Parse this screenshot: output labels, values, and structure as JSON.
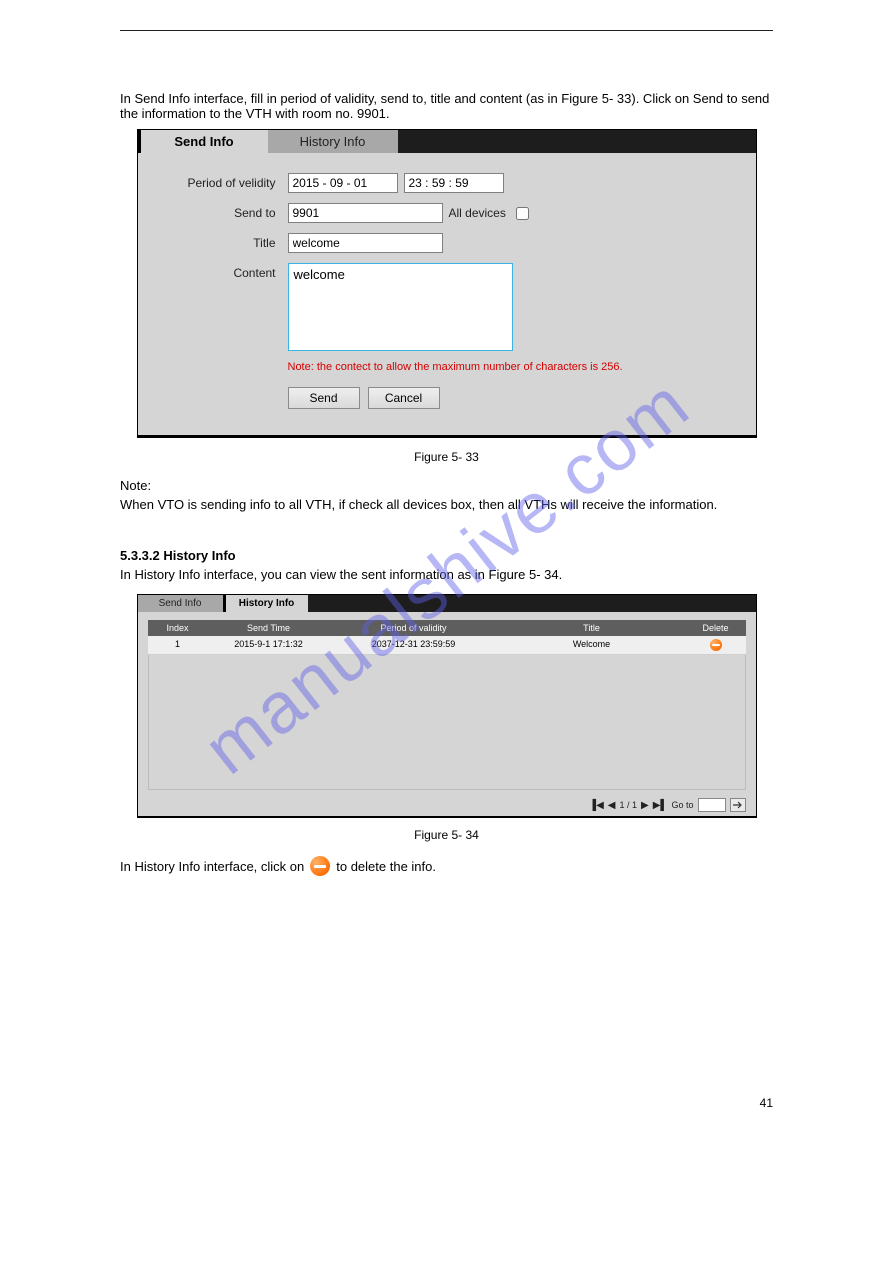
{
  "watermark": "manualshive.com",
  "intro": "In Send Info interface, fill in period of validity, send to, title and content (as in Figure 5- 33). Click on Send to send the information to the VTH with room no. 9901.",
  "pane1": {
    "tabs": {
      "active": "Send Info",
      "inactive": "History Info"
    },
    "fields": {
      "period_label": "Period of velidity",
      "date_value": "2015 - 09 - 01",
      "time_value": "23 : 59 : 59",
      "sendto_label": "Send to",
      "sendto_value": "9901",
      "alldevices_label": "All devices",
      "title_label": "Title",
      "title_value": "welcome",
      "content_label": "Content",
      "content_value": "welcome"
    },
    "note": "Note: the contect to allow the maximum number of characters is 256.",
    "buttons": {
      "send": "Send",
      "cancel": "Cancel"
    }
  },
  "caption1": "Figure 5- 33",
  "mid1": "Note:",
  "mid2": "When VTO is sending info to all VTH, if check all devices box, then all VTHs will receive the information.",
  "sec_heading": "5.3.3.2 History Info",
  "sec_body": "In History Info interface, you can view the sent information as in Figure 5- 34.",
  "pane2": {
    "tabs": {
      "inactive": "Send Info",
      "active": "History Info"
    },
    "headers": {
      "index": "Index",
      "send_time": "Send Time",
      "period": "Period of validity",
      "title": "Title",
      "del": "Delete"
    },
    "row": {
      "index": "1",
      "send_time": "2015-9-1 17:1:32",
      "period": "2037-12-31 23:59:59",
      "title": "Welcome"
    },
    "pager": {
      "pages": "1 / 1",
      "goto": "Go to"
    }
  },
  "caption2": "Figure 5- 34",
  "footer_line": "In History Info interface, click on       to delete the info.",
  "page_no": "41"
}
